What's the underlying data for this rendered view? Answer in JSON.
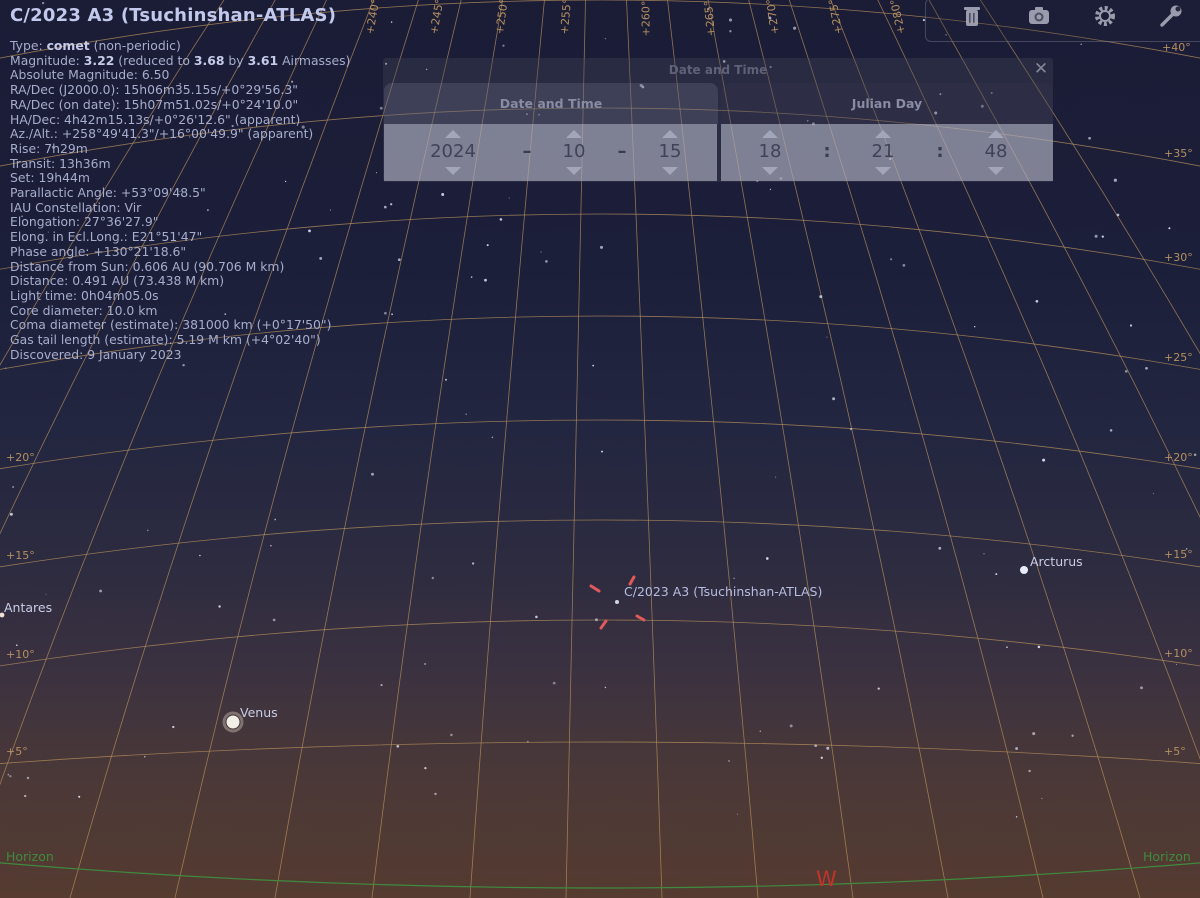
{
  "object": {
    "title": "C/2023 A3 (Tsuchinshan-ATLAS)",
    "info": {
      "type_label": "Type: ",
      "type_value": "comet",
      "type_suffix": " (non-periodic)",
      "mag_label": "Magnitude: ",
      "mag_value": "3.22",
      "mag_mid": " (reduced to ",
      "mag_reduced": "3.68",
      "mag_by": " by ",
      "airmasses": "3.61",
      "mag_end": " Airmasses)",
      "lines": [
        "Absolute Magnitude: 6.50",
        "RA/Dec (J2000.0): 15h06m35.15s/+0°29'56.3\"",
        "RA/Dec (on date): 15h07m51.02s/+0°24'10.0\"",
        "HA/Dec: 4h42m15.13s/+0°26'12.6\" (apparent)",
        "Az./Alt.: +258°49'41.3\"/+16°00'49.9\" (apparent)",
        "Rise: 7h29m",
        "Transit: 13h36m",
        "Set: 19h44m",
        "Parallactic Angle: +53°09'48.5\"",
        "IAU Constellation: Vir",
        "Elongation: 27°36'27.9\"",
        "Elong. in Ecl.Long.: E21°51'47\"",
        "Phase angle: +130°21'18.6\"",
        "Distance from Sun: 0.606 AU (90.706 M km)",
        "Distance: 0.491 AU (73.438 M km)",
        "Light time: 0h04m05.0s",
        "Core diameter: 10.0 km",
        "Coma diameter (estimate): 381000 km (+0°17'50\")",
        "Gas tail length (estimate): 5.19 M km (+4°02'40\")",
        "Discovered: 9 January 2023"
      ]
    }
  },
  "dialog": {
    "title": "Date and Time",
    "close_icon": "close-icon",
    "tab_date": "Date and Time",
    "tab_jd": "Julian Day",
    "date": {
      "year": "2024",
      "month": "10",
      "day": "15"
    },
    "time": {
      "hour": "18",
      "minute": "21",
      "second": "48"
    },
    "date_sep": "–",
    "time_sep": ":"
  },
  "toolbar": {
    "icons": [
      "trash-icon",
      "camera-icon",
      "settings-icon",
      "wrench-icon"
    ]
  },
  "sky": {
    "stars": [
      {
        "name": "Arcturus"
      },
      {
        "name": "Antares"
      },
      {
        "name": "Venus"
      }
    ],
    "comet_label": "C/2023 A3 (Tsuchinshan-ATLAS)",
    "horizon_label": "Horizon",
    "cardinal_west": "W",
    "alt_labels": [
      "+5°",
      "+10°",
      "+15°",
      "+20°",
      "+25°",
      "+30°",
      "+35°",
      "+40°"
    ],
    "az_labels": [
      "+240°",
      "+245°",
      "+250°",
      "+255°",
      "+260°",
      "+265°",
      "+270°",
      "+275°",
      "+280°"
    ]
  },
  "colors": {
    "grid": "#b8915c",
    "horizon": "#3f8a3f",
    "marker": "#e05a5a",
    "cardinal": "#c2332b"
  }
}
